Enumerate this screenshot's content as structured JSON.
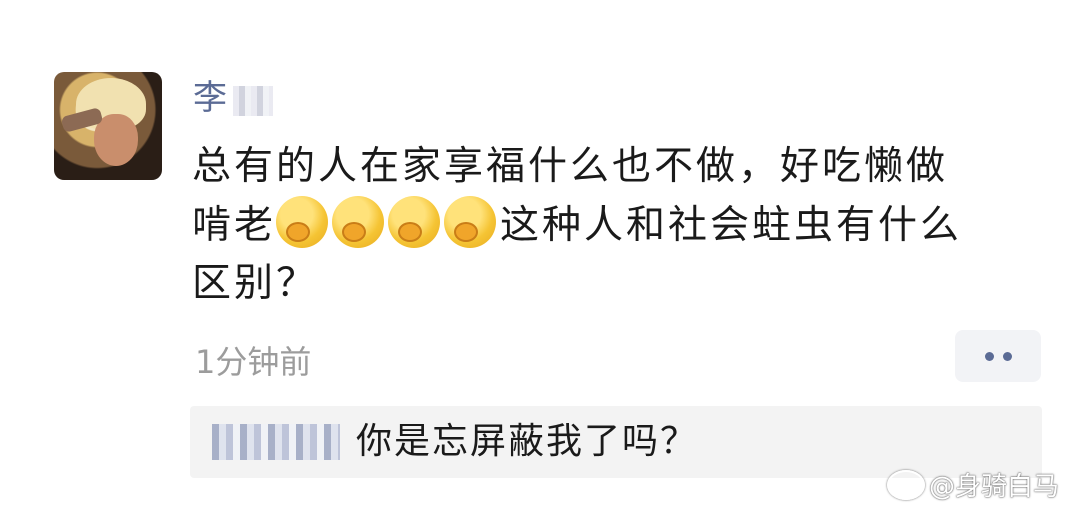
{
  "post": {
    "username": "李",
    "comment_lines": {
      "line1": "总有的人在家享福什么也不做，好吃懒做",
      "line2_prefix": "啃老",
      "line2_suffix": "这种人和社会蛀虫有什么",
      "line3": "区别？"
    },
    "emoji": {
      "name": "thinking-face-emoji",
      "count": 4
    },
    "timestamp": "1分钟前"
  },
  "reply": {
    "text": "你是忘屏蔽我了吗？"
  },
  "watermark": {
    "text": "@身骑白马"
  }
}
